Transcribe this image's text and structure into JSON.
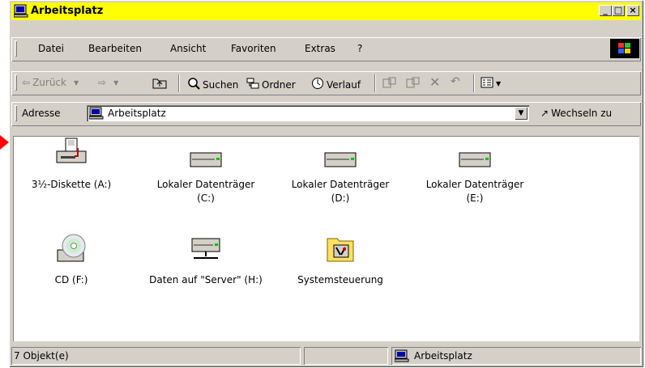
{
  "window": {
    "title": "Arbeitsplatz"
  },
  "titlebar_buttons": {
    "minimize": "_",
    "maximize": "□",
    "close": "×"
  },
  "menu": [
    "Datei",
    "Bearbeiten",
    "Ansicht",
    "Favoriten",
    "Extras",
    "?"
  ],
  "toolbar": {
    "back": "Zurück",
    "search": "Suchen",
    "folders": "Ordner",
    "history": "Verlauf"
  },
  "address": {
    "label": "Adresse",
    "value": "Arbeitsplatz",
    "go": "Wechseln zu"
  },
  "items": [
    {
      "label": "3½-Diskette (A:)",
      "icon": "floppy-drive-icon"
    },
    {
      "label": "Lokaler Datenträger (C:)",
      "icon": "hard-drive-icon"
    },
    {
      "label": "Lokaler Datenträger (D:)",
      "icon": "hard-drive-icon"
    },
    {
      "label": "Lokaler Datenträger (E:)",
      "icon": "hard-drive-icon"
    },
    {
      "label": "CD (F:)",
      "icon": "cd-drive-icon"
    },
    {
      "label": "Daten auf \"Server\" (H:)",
      "icon": "network-drive-icon"
    },
    {
      "label": "Systemsteuerung",
      "icon": "control-panel-icon"
    }
  ],
  "status": {
    "count": "7 Objekt(e)",
    "location": "Arbeitsplatz"
  },
  "colors": {
    "titlebar": "#ffff00",
    "chrome": "#d4d0c8",
    "pointer": "#ff0000"
  }
}
